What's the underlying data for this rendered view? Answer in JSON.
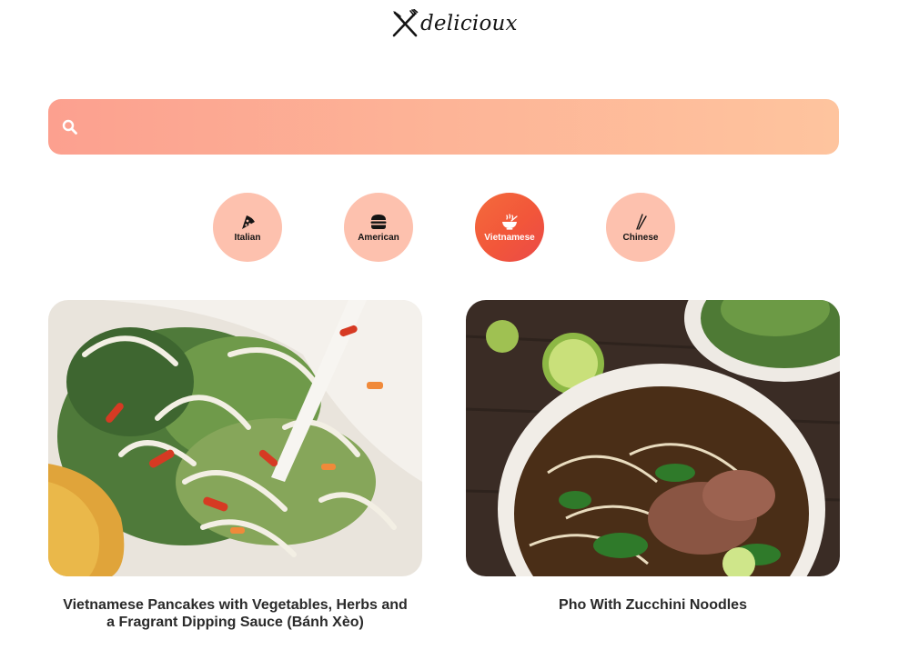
{
  "brand": {
    "logo_text": "delicioux"
  },
  "search": {
    "placeholder": "",
    "value": "",
    "gradient": [
      "#fca08f",
      "#fec49e"
    ]
  },
  "categories": [
    {
      "label": "Italian",
      "icon": "pizza-icon",
      "active": false
    },
    {
      "label": "American",
      "icon": "burger-icon",
      "active": false
    },
    {
      "label": "Vietnamese",
      "icon": "noodle-bowl-icon",
      "active": true
    },
    {
      "label": "Chinese",
      "icon": "chopsticks-icon",
      "active": false
    }
  ],
  "recipes": [
    {
      "title": "Vietnamese Pancakes with Vegetables, Herbs and a Fragrant Dipping Sauce (Bánh Xèo)",
      "image": "photo of banh xeo with bean sprouts, herbs and chili"
    },
    {
      "title": "Pho With Zucchini Noodles",
      "image": "photo of pho bowl with beef, herbs and lime on dark wood"
    }
  ],
  "colors": {
    "accent": "#f2563a",
    "chip": "#fdc1ae",
    "text": "#2a2a2a"
  }
}
